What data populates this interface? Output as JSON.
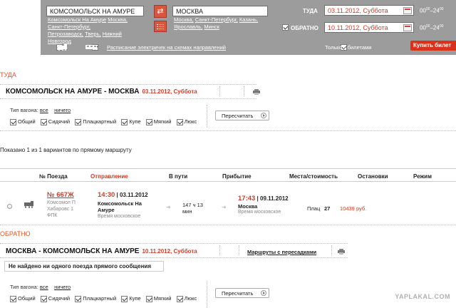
{
  "search": {
    "from_value": "КОМСОМОЛЬСК НА АМУРЕ",
    "from_suggestions": [
      "Комсомольск На Амуре",
      "Москва,",
      "Санкт-Петербург,",
      "Петрозаводск,",
      "Тверь,",
      "Нижний",
      "Новгород"
    ],
    "to_value": "МОСКВА",
    "to_suggestions": [
      "Москва,",
      "Санкт-Петербург,",
      "Казань,",
      "Ярославль,",
      "Минск"
    ],
    "there_label": "ТУДА",
    "there_date": "03.11.2012, Суббота",
    "back_label": "ОБРАТНО",
    "back_date": "10.11.2012, Суббота",
    "time_from": "00",
    "time_to": "24",
    "time_sup": "00",
    "time_dash": "–",
    "schedule_link": "Расписание электричек на схемах направлений",
    "only_tickets": "Только с билетами",
    "buy_button": "Купить билет"
  },
  "outbound": {
    "section_label": "ТУДА",
    "route": "КОМСОМОЛЬСК НА АМУРЕ - МОСКВА",
    "date": "03.11.2012, Суббота",
    "wagon_type_label": "Тип вагона:",
    "all_link": "все",
    "none_link": "ничего",
    "wagons": [
      "Общий",
      "Сидячий",
      "Плацкартный",
      "Купе",
      "Мягкий",
      "Люкс"
    ],
    "recalc_button": "Пересчитать",
    "shown_text": "Показано 1 из 1 вариантов по прямому маршруту"
  },
  "table": {
    "headers": {
      "num": "№ Поезда",
      "departure": "Отправление",
      "on_way": "В пути",
      "arrival": "Прибытие",
      "seats": "Места/стоимость",
      "stops": "Остановки",
      "mode": "Режим"
    },
    "row": {
      "train_no": "№ 667Ж",
      "train_desc_1": "Комсомол П",
      "train_desc_2": "Хабаровс 1",
      "train_desc_3": "ФПК",
      "dep_time": "14:30",
      "dep_date": "| 03.11.2012",
      "dep_station_1": "Комсомольск На",
      "dep_station_2": "Амуре",
      "dep_tz": "Время московское",
      "duration_1": "147 ч 13",
      "duration_2": "мин",
      "arr_time": "17:43",
      "arr_date": "| 09.11.2012",
      "arr_station": "Москва",
      "arr_tz": "Время московское",
      "seat_type": "Плац",
      "seat_count": "27",
      "price": "10439 руб."
    }
  },
  "return": {
    "section_label": "ОБРАТНО",
    "route": "МОСКВА - КОМСОМОЛЬСК НА АМУРЕ",
    "date": "10.11.2012, Суббота",
    "transfers_link": "Маршруты с пересадками",
    "not_found": "Не найдено ни одного поезда прямого сообщения",
    "wagon_type_label": "Тип вагона:",
    "all_link": "все",
    "none_link": "ничего",
    "wagons": [
      "Общий",
      "Сидячий",
      "Плацкартный",
      "Купе",
      "Мягкий",
      "Люкс"
    ],
    "recalc_button": "Пересчитать"
  },
  "watermark": "YAPLAKAL.COM"
}
